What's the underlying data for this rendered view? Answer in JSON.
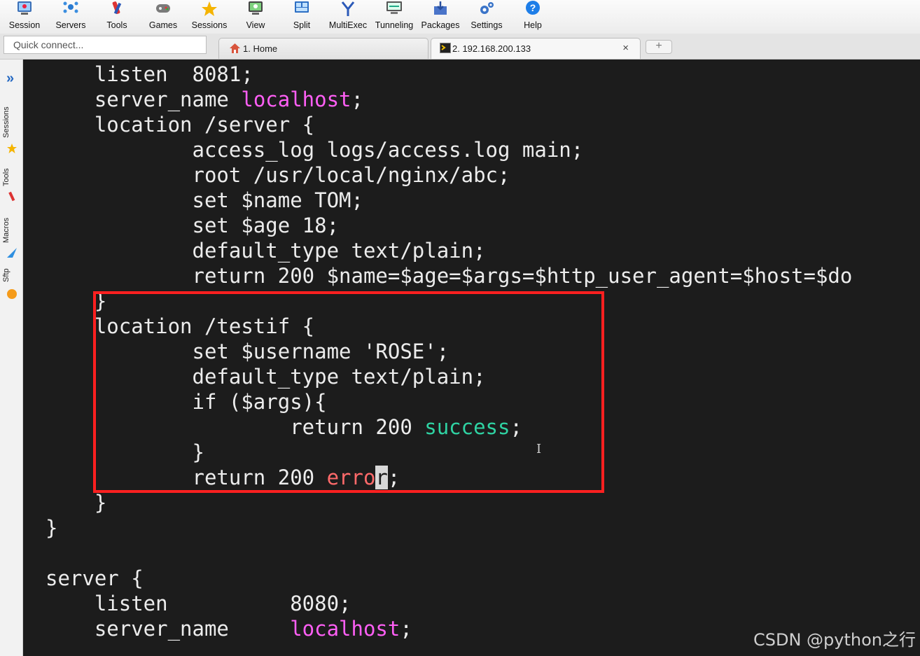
{
  "toolbar": {
    "items": [
      {
        "label": "Session",
        "icon": "session-icon"
      },
      {
        "label": "Servers",
        "icon": "servers-icon"
      },
      {
        "label": "Tools",
        "icon": "tools-icon"
      },
      {
        "label": "Games",
        "icon": "games-icon"
      },
      {
        "label": "Sessions",
        "icon": "star-icon"
      },
      {
        "label": "View",
        "icon": "view-icon"
      },
      {
        "label": "Split",
        "icon": "split-icon"
      },
      {
        "label": "MultiExec",
        "icon": "multiexec-icon"
      },
      {
        "label": "Tunneling",
        "icon": "tunneling-icon"
      },
      {
        "label": "Packages",
        "icon": "packages-icon"
      },
      {
        "label": "Settings",
        "icon": "settings-icon"
      },
      {
        "label": "Help",
        "icon": "help-icon"
      }
    ]
  },
  "quick_connect": {
    "placeholder": "Quick connect..."
  },
  "tabs": [
    {
      "label": "1. Home",
      "icon": "home-icon"
    },
    {
      "label": "2. 192.168.200.133",
      "icon": "terminal-icon",
      "close": "×"
    }
  ],
  "new_tab": "+",
  "sidebar": {
    "labels": [
      "Sessions",
      "Tools",
      "Macros",
      "Sftp"
    ]
  },
  "terminal": {
    "lines": {
      "l1": "    listen  8081;",
      "l2a": "    server_name ",
      "l2b": "localhost",
      "l2c": ";",
      "l3": "    location /server {",
      "l4": "            access_log logs/access.log main;",
      "l5": "            root /usr/local/nginx/abc;",
      "l6": "            set $name TOM;",
      "l7": "            set $age 18;",
      "l8": "            default_type text/plain;",
      "l9": "            return 200 $name=$age=$args=$http_user_agent=$host=$do",
      "l10": "    }",
      "l11": "    location /testif {",
      "l12": "            set $username 'ROSE';",
      "l13": "            default_type text/plain;",
      "l14": "            if ($args){",
      "l15a": "                    return 200 ",
      "l15b": "success",
      "l15c": ";",
      "l16": "            }",
      "l17a": "            return 200 ",
      "l17b": "erro",
      "l17cur": "r",
      "l17c": ";",
      "l18": "    }",
      "l19": "}",
      "l20": "",
      "l21": "server {",
      "l22": "    listen          8080;",
      "l23a": "    server_name     ",
      "l23b": "localhost",
      "l23c": ";"
    }
  },
  "watermark": "CSDN @python之行",
  "colors": {
    "terminal_bg": "#1c1c1c",
    "highlight_box": "#ff2020",
    "keyword_magenta": "#ff5ff5",
    "success_green": "#2fd3a3",
    "error_red": "#ff6a6a"
  }
}
